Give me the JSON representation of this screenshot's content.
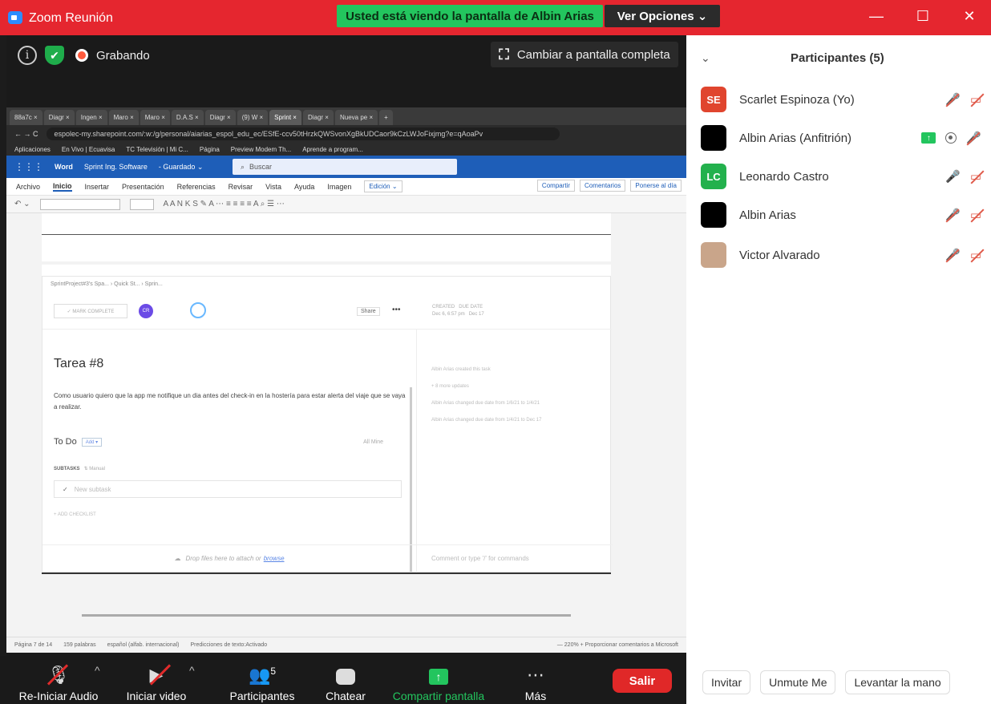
{
  "window": {
    "title": "Zoom Reunión",
    "banner": "Usted está viendo la pantalla de Albin Arias",
    "view_options": "Ver Opciones ⌄",
    "minimize": "—",
    "maximize": "☐",
    "close": "✕"
  },
  "status": {
    "recording_label": "Grabando",
    "fullscreen_label": "Cambiar a pantalla completa"
  },
  "shared_screen": {
    "tabs": [
      "88a7c ×",
      "Diagr ×",
      "Ingen ×",
      "Maro ×",
      "Maro ×",
      "D.A.S ×",
      "Diagr ×",
      "(9) W ×",
      "Sprint ×",
      "Diagr ×",
      "Nueva pe ×",
      "+"
    ],
    "active_tab_index": 8,
    "address": "espolec-my.sharepoint.com/:w:/g/personal/aiarias_espol_edu_ec/ESfE-ccv50tHrzkQWSvonXgBkUDCaor9kCzLWJoFixjmg?e=qAoaPv",
    "bookmarks": [
      "Aplicaciones",
      "En Vivo | Ecuavisa",
      "TC Televisión | Mi C...",
      "Página",
      "Preview Modem Th...",
      "Aprende a program..."
    ],
    "word": {
      "app": "Word",
      "doc_title": "Sprint Ing. Software",
      "doc_status": "- Guardado ⌄",
      "search_placeholder": "Buscar",
      "ribbon_tabs": [
        "Archivo",
        "Inicio",
        "Insertar",
        "Presentación",
        "Referencias",
        "Revisar",
        "Vista",
        "Ayuda",
        "Imagen"
      ],
      "active_ribbon_tab": "Inicio",
      "edit_mode": "Edición ⌄",
      "share_btn": "Compartir",
      "comments_btn": "Comentarios",
      "meeting_btn": "Ponerse al día",
      "status_bar": {
        "page": "Página 7 de 14",
        "words": "159 palabras",
        "language": "español (alfab. internacional)",
        "predictions": "Predicciones de texto:Activado",
        "zoom": "—  220%  +    Proporcionar comentarios a Microsoft"
      }
    },
    "clickup": {
      "breadcrumb": "SprintProject#3's Spa...  ›  Quick St...  ›  Sprin...",
      "mark_complete": "✓ MARK COMPLETE",
      "avatar": "CR",
      "share": "Share",
      "created_label": "CREATED",
      "created_value": "Dec 6, 6:57 pm",
      "due_label": "DUE DATE",
      "due_value": "Dec 17",
      "task_title": "Tarea #8",
      "description": "Como usuario quiero que la app me notifique un dia antes del check-in en la hostería para estar alerta del viaje que se vaya a realizar.",
      "status": "To Do",
      "add_label": "Add ▾",
      "all_mine": "All   Mine",
      "subtasks_label": "SUBTASKS",
      "manual_label": "⇅ Manual",
      "new_subtask": "New subtask",
      "add_checklist": "+ ADD CHECKLIST",
      "drop_text": "Drop files here to attach or",
      "browse": "browse",
      "activity": [
        "Albin Arias created this task",
        "+ 8 more updates",
        "Albin Arias changed due date from 1/6/21 to 1/4/21",
        "Albin Arias changed due date from 1/4/21 to Dec 17"
      ],
      "comment_placeholder": "Comment or type '/' for commands"
    }
  },
  "toolbar": {
    "audio": "Re-Iniciar Audio",
    "video": "Iniciar video",
    "participants": "Participantes",
    "participants_count": "5",
    "chat": "Chatear",
    "share": "Compartir pantalla",
    "more": "Más",
    "leave": "Salir",
    "caret": "^"
  },
  "participants_panel": {
    "title": "Participantes (5)",
    "list": [
      {
        "initials": "SE",
        "name": "Scarlet Espinoza (Yo)",
        "avatar_color": "#e0452e"
      },
      {
        "initials": "",
        "name": "Albin Arias (Anfitrión)",
        "avatar_color": "#000000"
      },
      {
        "initials": "LC",
        "name": "Leonardo Castro",
        "avatar_color": "#23b14d"
      },
      {
        "initials": "",
        "name": "Albin Arias",
        "avatar_color": "#000000"
      },
      {
        "initials": "",
        "name": "Victor Alvarado",
        "avatar_color": "#c9a58a"
      }
    ],
    "invite": "Invitar",
    "unmute": "Unmute Me",
    "raise_hand": "Levantar la mano"
  },
  "colors": {
    "titlebar": "#e5262f",
    "banner": "#23c55e",
    "leave": "#e02828",
    "muted": "#e05a4a"
  }
}
